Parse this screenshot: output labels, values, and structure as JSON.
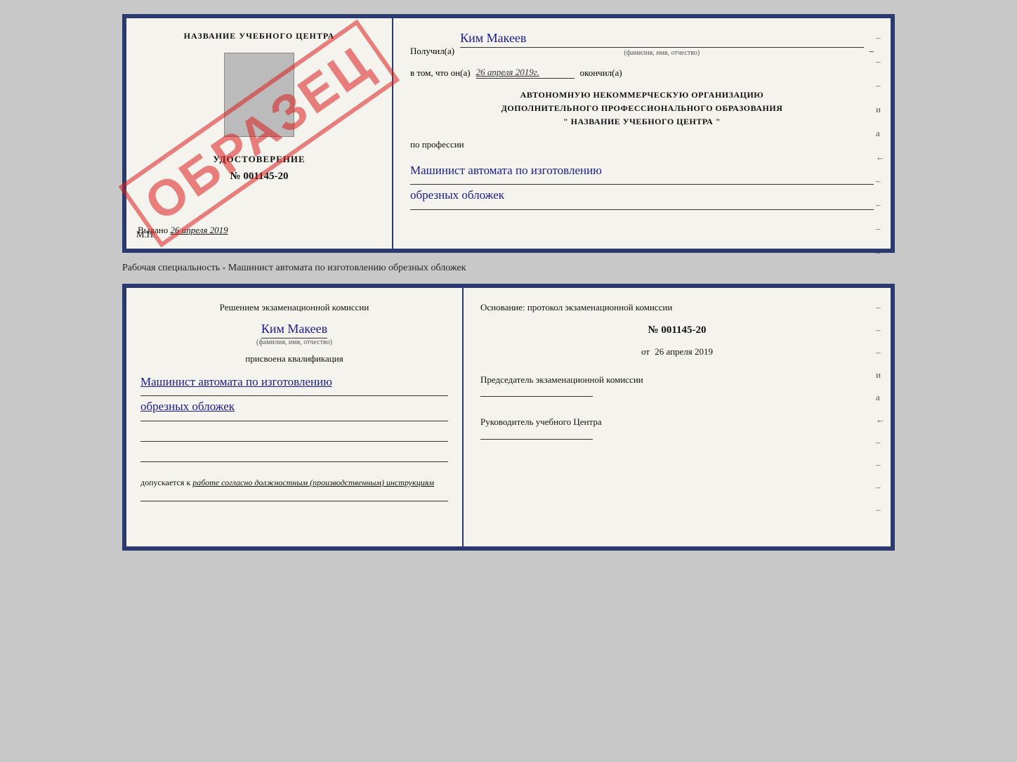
{
  "topCert": {
    "left": {
      "title": "НАЗВАНИЕ УЧЕБНОГО ЦЕНТРА",
      "watermark": "ОБРАЗЕЦ",
      "udostLabel": "УДОСТОВЕРЕНИЕ",
      "number": "№ 001145-20",
      "vydanoLabel": "Выдано",
      "vydanoDate": "26 апреля 2019",
      "mpLabel": "М.П."
    },
    "right": {
      "poluchilLabel": "Получил(а)",
      "recipientName": "Ким Макеев",
      "fioHint": "(фамилия, имя, отчество)",
      "vtomLabel": "в том, что он(а)",
      "completionDate": "26 апреля 2019г.",
      "okonchilLabel": "окончил(а)",
      "orgLine1": "АВТОНОМНУЮ НЕКОММЕРЧЕСКУЮ ОРГАНИЗАЦИЮ",
      "orgLine2": "ДОПОЛНИТЕЛЬНОГО ПРОФЕССИОНАЛЬНОГО ОБРАЗОВАНИЯ",
      "orgName": "\"  НАЗВАНИЕ УЧЕБНОГО ЦЕНТРА  \"",
      "poProfessiiLabel": "по профессии",
      "profession1": "Машинист автомата по изготовлению",
      "profession2": "обрезных обложек",
      "dashes": [
        "-",
        "-",
        "-",
        "и",
        "а",
        "←",
        "-",
        "-",
        "-",
        "-"
      ]
    }
  },
  "separatorText": "Рабочая специальность - Машинист автомата по изготовлению обрезных обложек",
  "bottomCert": {
    "left": {
      "reshenieLabel": "Решением экзаменационной комиссии",
      "name": "Ким Макеев",
      "fioHint": "(фамилия, имя, отчество)",
      "prisvoenaLabel": "присвоена квалификация",
      "kvalif1": "Машинист автомата по изготовлению",
      "kvalif2": "обрезных обложек",
      "dopuskaetsyaLabel": "допускается к",
      "dopuskaetsyaText": "работе согласно должностным (производственным) инструкциям"
    },
    "right": {
      "osnovanieLable": "Основание: протокол экзаменационной комиссии",
      "protokolNumber": "№ 001145-20",
      "otLabel": "от",
      "otDate": "26 апреля 2019",
      "predsedatelLabel": "Председатель экзаменационной комиссии",
      "rukovoditelLabel": "Руководитель учебного Центра",
      "dashes": [
        "-",
        "-",
        "-",
        "и",
        "а",
        "←",
        "-",
        "-",
        "-",
        "-"
      ]
    }
  }
}
